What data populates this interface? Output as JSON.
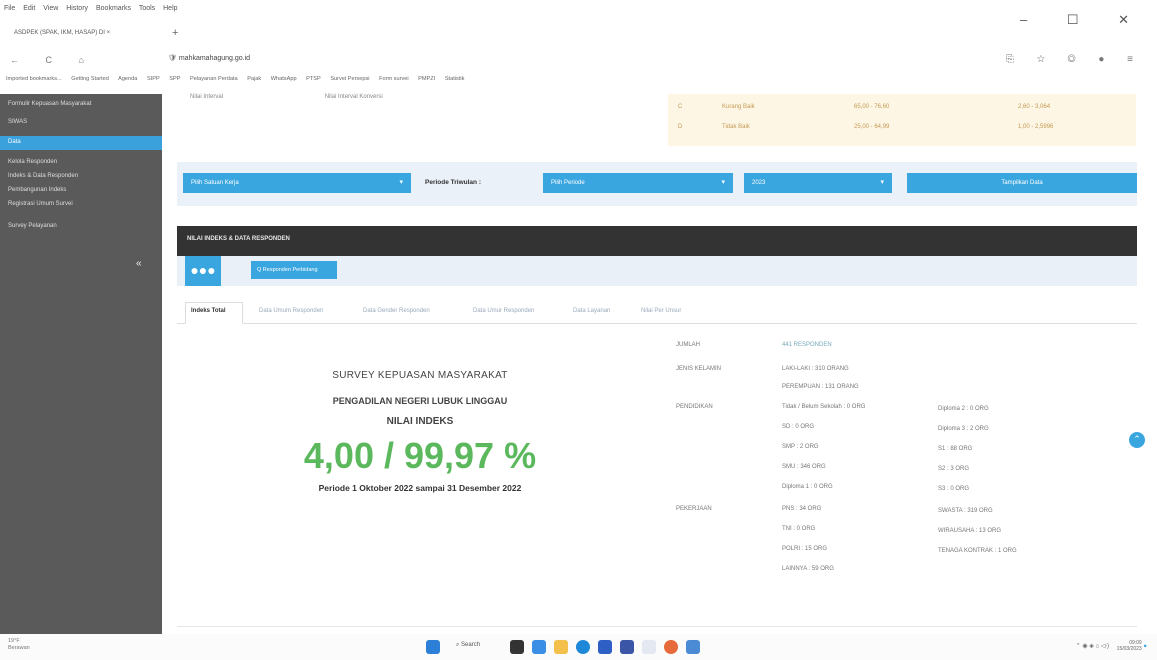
{
  "browser": {
    "menu": [
      "File",
      "Edit",
      "View",
      "History",
      "Bookmarks",
      "Tools",
      "Help"
    ],
    "tab_title": "ASDPEK (SPAK, IKM, HASAP) DI ×",
    "new_tab": "+",
    "window_controls": "– ☐ ✕",
    "nav_icons": "← C ⌂",
    "url_prefix": "",
    "url_host": "mahkamahagung.go.id",
    "bookmarks": [
      "Imported bookmarks...",
      "Getting Started",
      "Agenda",
      "SIPP",
      "SPP",
      "Pelayanan Perdata",
      "Pajak",
      "WhatsApp",
      "PTSP",
      "Survei Persepsi",
      "Form survei",
      "PMPZI",
      "Statistik"
    ]
  },
  "sidebar": {
    "items": [
      "Formulir Kepuasan Masyarakat",
      "SIWAS",
      "Data",
      "Kelola Responden",
      "Indeks & Data Responden",
      "Pembangunan Indeks",
      "Registrasi Umum Survei",
      "Survey Pelayanan"
    ],
    "collapse": "«"
  },
  "top_labels": {
    "left1": "Nilai Interval",
    "left2": "Nilai Interval Konversi"
  },
  "score_table": {
    "rows": [
      {
        "mutu": "C",
        "kinerja": "Kurang Baik",
        "interval_konversi": "65,00 - 76,60",
        "interval": "2,60 - 3,064"
      },
      {
        "mutu": "D",
        "kinerja": "Tidak Baik",
        "interval_konversi": "25,00 - 64,99",
        "interval": "1,00 - 2,5996"
      }
    ]
  },
  "filters": {
    "satuan_kerja": "Pilih Satuan Kerja",
    "periode_label": "Periode Triwulan :",
    "periode": "Pilih Periode",
    "tahun": "2023",
    "tampilkan": "Tampilkan Data"
  },
  "section": {
    "title": "NILAI INDEKS & DATA RESPONDEN",
    "responden_btn": "Q  Responden Perbidang"
  },
  "tabs": [
    "Indeks Total",
    "Data Umum Responden",
    "Data Gender Responden",
    "Data Umur Responden",
    "Data Layanan",
    "Nilai Per Unsur"
  ],
  "survey": {
    "title": "SURVEY KEPUASAN MASYARAKAT",
    "org": "PENGADILAN NEGERI LUBUK LINGGAU",
    "label": "NILAI INDEKS",
    "score": "4,00 / 99,97 %",
    "period": "Periode 1 Oktober 2022 sampai 31 Desember 2022"
  },
  "info": {
    "jumlah_label": "JUMLAH",
    "jumlah_value": "441 RESPONDEN",
    "jk_label": "JENIS KELAMIN",
    "laki": "LAKI-LAKI : 310 ORANG",
    "perempuan": "PEREMPUAN : 131 ORANG",
    "pendidikan_label": "PENDIDIKAN",
    "pend_col1": [
      "Tidak / Belum Sekolah : 0 ORG",
      "SD : 0 ORG",
      "SMP : 2 ORG",
      "SMU : 346 ORG",
      "Diploma 1 : 0 ORG"
    ],
    "pend_col2": [
      "Diploma 2 : 0 ORG",
      "Diploma 3 : 2 ORG",
      "S1 : 88 ORG",
      "S2 : 3 ORG",
      "S3 : 0 ORG"
    ],
    "pekerjaan_label": "PEKERJAAN",
    "pek_col1": [
      "PNS : 34 ORG",
      "TNI : 0 ORG",
      "POLRI : 15 ORG",
      "LAINNYA : 59 ORG"
    ],
    "pek_col2": [
      "SWASTA : 319 ORG",
      "WIRAUSAHA : 13 ORG",
      "TENAGA KONTRAK : 1 ORG"
    ]
  },
  "taskbar": {
    "weather_temp": "19°F",
    "weather_text": "Berawan",
    "search": "Search",
    "time": "09:09",
    "date": "15/03/2023"
  },
  "colors": {
    "accent": "#3aa6e0",
    "score_green": "#5bb85d",
    "sidebar_bg": "#5a5a5a",
    "section_dark": "#333333"
  }
}
